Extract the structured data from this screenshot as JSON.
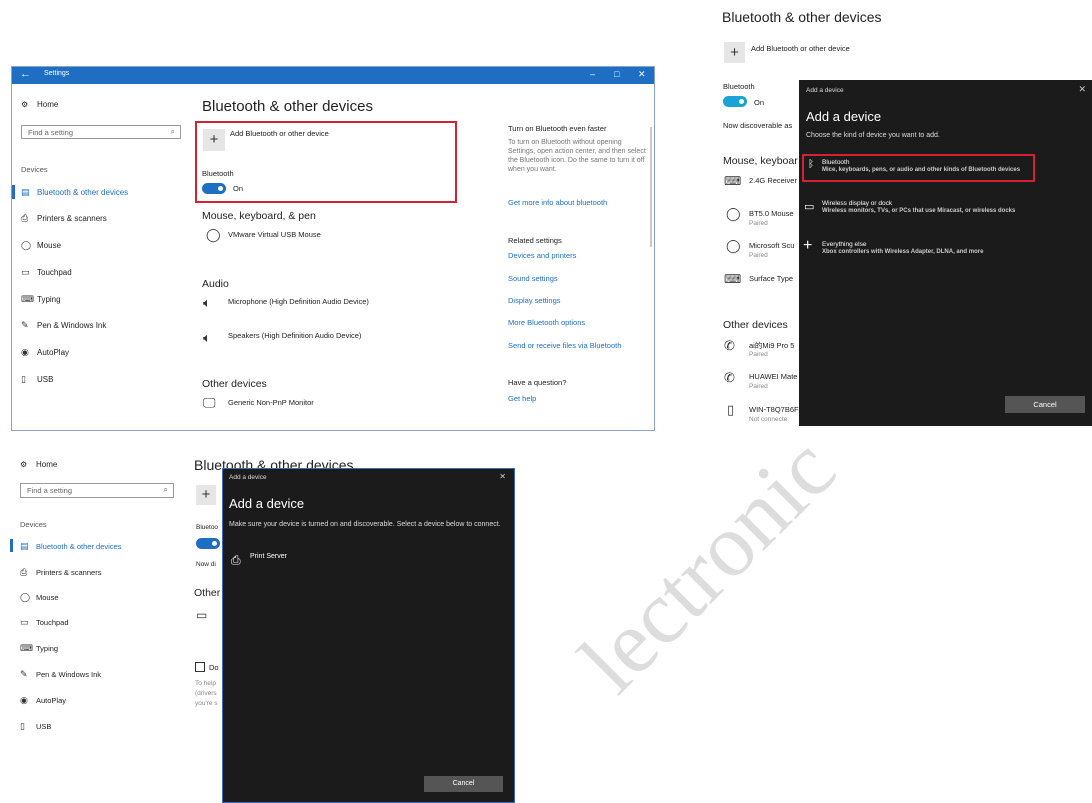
{
  "panel1": {
    "window_title": "Settings",
    "nav": {
      "home": "Home",
      "search_placeholder": "Find a setting",
      "category": "Devices",
      "items": [
        {
          "label": "Bluetooth & other devices",
          "icon": "bluetooth-icon"
        },
        {
          "label": "Printers & scanners",
          "icon": "printer-icon"
        },
        {
          "label": "Mouse",
          "icon": "mouse-icon"
        },
        {
          "label": "Touchpad",
          "icon": "touchpad-icon"
        },
        {
          "label": "Typing",
          "icon": "keyboard-icon"
        },
        {
          "label": "Pen & Windows Ink",
          "icon": "pen-icon"
        },
        {
          "label": "AutoPlay",
          "icon": "autoplay-icon"
        },
        {
          "label": "USB",
          "icon": "usb-icon"
        }
      ]
    },
    "main": {
      "title": "Bluetooth & other devices",
      "add_label": "Add Bluetooth or other device",
      "bt_label": "Bluetooth",
      "bt_state": "On",
      "mkp_title": "Mouse, keyboard, & pen",
      "mouse_device": "VMware Virtual USB Mouse",
      "audio_title": "Audio",
      "audio_mic": "Microphone (High Definition Audio Device)",
      "audio_spk": "Speakers (High Definition Audio Device)",
      "other_title": "Other devices",
      "other_monitor": "Generic Non-PnP Monitor"
    },
    "right": {
      "head": "Turn on Bluetooth even faster",
      "text": "To turn on Bluetooth without opening Settings, open action center, and then select the Bluetooth icon. Do the same to turn it off when you want.",
      "more_link": "Get more info about bluetooth",
      "related_head": "Related settings",
      "links": [
        "Devices and printers",
        "Sound settings",
        "Display settings",
        "More Bluetooth options",
        "Send or receive files via Bluetooth"
      ],
      "question": "Have a question?",
      "help": "Get help"
    }
  },
  "panel2": {
    "title": "Bluetooth & other devices",
    "add_label": "Add Bluetooth or other device",
    "bt_label": "Bluetooth",
    "bt_state": "On",
    "discoverable": "Now discoverable as",
    "mkp_title": "Mouse, keyboar",
    "devices": [
      {
        "name": "2.4G Receiver",
        "status": "",
        "icon": "keyboard-icon"
      },
      {
        "name": "BT5.0 Mouse",
        "status": "Paired",
        "icon": "mouse-icon"
      },
      {
        "name": "Microsoft Scu",
        "status": "Paired",
        "icon": "mouse-icon"
      },
      {
        "name": "Surface Type",
        "status": "",
        "icon": "keyboard-icon"
      }
    ],
    "other_title": "Other devices",
    "other_devices": [
      {
        "name": "ai的Mi9 Pro 5",
        "status": "Paired",
        "icon": "phone-icon"
      },
      {
        "name": "HUAWEI Mate",
        "status": "Paired",
        "icon": "phone-icon"
      },
      {
        "name": "WIN-T8Q7B6F",
        "status": "Not connecte",
        "icon": "computer-icon"
      }
    ],
    "dialog": {
      "title": "Add a device",
      "heading": "Add a device",
      "prompt": "Choose the kind of device you want to add.",
      "options": [
        {
          "title": "Bluetooth",
          "desc": "Mice, keyboards, pens, or audio and other kinds of Bluetooth devices"
        },
        {
          "title": "Wireless display or dock",
          "desc": "Wireless monitors, TVs, or PCs that use Miracast, or wireless docks"
        },
        {
          "title": "Everything else",
          "desc": "Xbox controllers with Wireless Adapter, DLNA, and more"
        }
      ],
      "cancel": "Cancel"
    }
  },
  "panel3": {
    "nav": {
      "home": "Home",
      "search_placeholder": "Find a setting",
      "category": "Devices",
      "items": [
        "Bluetooth & other devices",
        "Printers & scanners",
        "Mouse",
        "Touchpad",
        "Typing",
        "Pen & Windows Ink",
        "AutoPlay",
        "USB"
      ]
    },
    "title": "Bluetooth & other devices",
    "bt_partial": "Bluetoo",
    "discover_partial": "Now di",
    "other_partial": "Other",
    "d_partial": "Do",
    "help_partial_1": "To help",
    "help_partial_2": "(drivers",
    "help_partial_3": "you're s",
    "dialog": {
      "title": "Add a device",
      "heading": "Add a device",
      "prompt": "Make sure your device is turned on and discoverable. Select a device below to connect.",
      "device": "Print Server",
      "cancel": "Cancel"
    }
  },
  "watermark": "lectronic"
}
